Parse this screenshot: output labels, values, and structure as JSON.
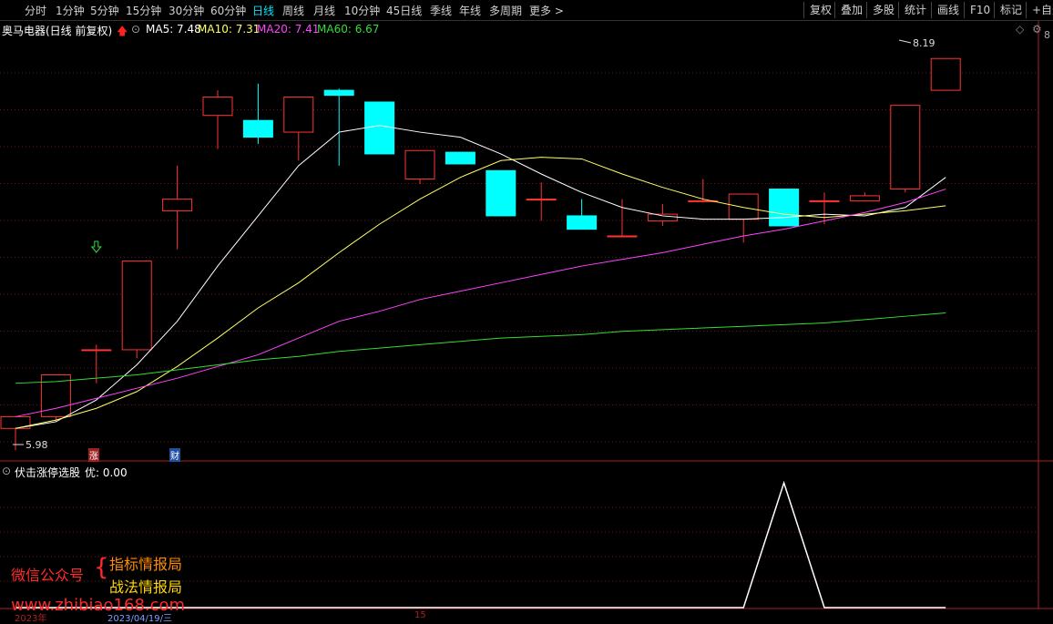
{
  "toolbar": {
    "periods": [
      "分时",
      "1分钟",
      "5分钟",
      "15分钟",
      "30分钟",
      "60分钟",
      "日线",
      "周线",
      "月线",
      "10分钟",
      "45日线",
      "季线",
      "年线",
      "多周期",
      "更多 >"
    ],
    "active_period": "日线",
    "right_buttons": [
      "复权",
      "叠加",
      "多股",
      "统计",
      "画线",
      "F10",
      "标记",
      "+自选"
    ]
  },
  "info": {
    "stock_title": "奥马电器(日线 前复权)",
    "ma5": "MA5: 7.48",
    "ma10": "MA10: 7.31",
    "ma20": "MA20: 7.41",
    "ma60": "MA60: 6.67",
    "colors": {
      "ma5": "#ffffff",
      "ma10": "#ffff66",
      "ma20": "#ff44ff",
      "ma60": "#33dd33",
      "up": "#ff3333",
      "down": "#00ffff"
    }
  },
  "price_labels": {
    "high": "8.19",
    "low": "5.98",
    "right_axis_top": "8"
  },
  "markers": {
    "zhang": "涨",
    "cai": "财"
  },
  "indicator": {
    "label": "伏击涨停选股",
    "value_text": "优: 0.00"
  },
  "bottom_axis": {
    "label1": "2023年",
    "label2": "2023/04/19/三",
    "label3": "15"
  },
  "watermark": {
    "left": "微信公众号",
    "line1": "指标情报局",
    "line2": "战法情报局",
    "url": "www.zhibiao168.com"
  },
  "chart_data": {
    "type": "candlestick",
    "price_axis": {
      "ymin": 5.9,
      "ymax": 8.3
    },
    "candles": [
      {
        "o": 5.98,
        "h": 6.05,
        "l": 5.85,
        "c": 6.05
      },
      {
        "o": 6.05,
        "h": 6.3,
        "l": 6.02,
        "c": 6.3
      },
      {
        "o": 6.45,
        "h": 6.48,
        "l": 6.25,
        "c": 6.45
      },
      {
        "o": 6.45,
        "h": 6.98,
        "l": 6.4,
        "c": 6.98
      },
      {
        "o": 7.28,
        "h": 7.55,
        "l": 7.05,
        "c": 7.35
      },
      {
        "o": 7.85,
        "h": 8.0,
        "l": 7.65,
        "c": 7.96
      },
      {
        "o": 7.82,
        "h": 8.04,
        "l": 7.68,
        "c": 7.72
      },
      {
        "o": 7.75,
        "h": 7.91,
        "l": 7.58,
        "c": 7.96
      },
      {
        "o": 8.0,
        "h": 8.01,
        "l": 7.55,
        "c": 7.97
      },
      {
        "o": 7.93,
        "h": 7.93,
        "l": 7.62,
        "c": 7.62
      },
      {
        "o": 7.47,
        "h": 7.57,
        "l": 7.44,
        "c": 7.64
      },
      {
        "o": 7.63,
        "h": 7.63,
        "l": 7.56,
        "c": 7.56
      },
      {
        "o": 7.52,
        "h": 7.52,
        "l": 7.25,
        "c": 7.25
      },
      {
        "o": 7.35,
        "h": 7.45,
        "l": 7.22,
        "c": 7.35
      },
      {
        "o": 7.25,
        "h": 7.35,
        "l": 7.17,
        "c": 7.17
      },
      {
        "o": 7.13,
        "h": 7.35,
        "l": 7.13,
        "c": 7.13
      },
      {
        "o": 7.22,
        "h": 7.32,
        "l": 7.19,
        "c": 7.26
      },
      {
        "o": 7.34,
        "h": 7.47,
        "l": 7.34,
        "c": 7.34
      },
      {
        "o": 7.23,
        "h": 7.38,
        "l": 7.09,
        "c": 7.38
      },
      {
        "o": 7.41,
        "h": 7.41,
        "l": 7.19,
        "c": 7.19
      },
      {
        "o": 7.34,
        "h": 7.39,
        "l": 7.2,
        "c": 7.34
      },
      {
        "o": 7.34,
        "h": 7.39,
        "l": 7.37,
        "c": 7.37
      },
      {
        "o": 7.41,
        "h": 7.64,
        "l": 7.39,
        "c": 7.91
      },
      {
        "o": 8.0,
        "h": 8.0,
        "l": 8.16,
        "c": 8.19
      }
    ],
    "series": [
      {
        "name": "MA5",
        "values": [
          5.98,
          6.02,
          6.15,
          6.36,
          6.62,
          6.95,
          7.25,
          7.55,
          7.75,
          7.79,
          7.75,
          7.72,
          7.62,
          7.5,
          7.39,
          7.3,
          7.25,
          7.23,
          7.23,
          7.24,
          7.26,
          7.25,
          7.3,
          7.48
        ]
      },
      {
        "name": "MA10",
        "values": [
          5.98,
          6.03,
          6.1,
          6.2,
          6.35,
          6.52,
          6.7,
          6.85,
          7.03,
          7.2,
          7.35,
          7.48,
          7.58,
          7.6,
          7.59,
          7.5,
          7.42,
          7.35,
          7.3,
          7.26,
          7.24,
          7.26,
          7.28,
          7.31
        ]
      },
      {
        "name": "MA20",
        "values": [
          6.05,
          6.1,
          6.16,
          6.22,
          6.28,
          6.35,
          6.42,
          6.52,
          6.62,
          6.68,
          6.75,
          6.8,
          6.85,
          6.9,
          6.95,
          6.99,
          7.03,
          7.08,
          7.13,
          7.17,
          7.22,
          7.27,
          7.33,
          7.41
        ]
      },
      {
        "name": "MA60",
        "values": [
          6.25,
          6.26,
          6.28,
          6.3,
          6.33,
          6.36,
          6.39,
          6.41,
          6.44,
          6.46,
          6.48,
          6.5,
          6.52,
          6.53,
          6.54,
          6.56,
          6.57,
          6.58,
          6.59,
          6.6,
          6.61,
          6.63,
          6.65,
          6.67
        ]
      }
    ],
    "indicator_values": [
      0,
      0,
      0,
      0,
      0,
      0,
      0,
      0,
      0,
      0,
      0,
      0,
      0,
      0,
      0,
      0,
      0,
      0,
      0,
      1,
      0,
      0,
      0,
      0
    ]
  }
}
